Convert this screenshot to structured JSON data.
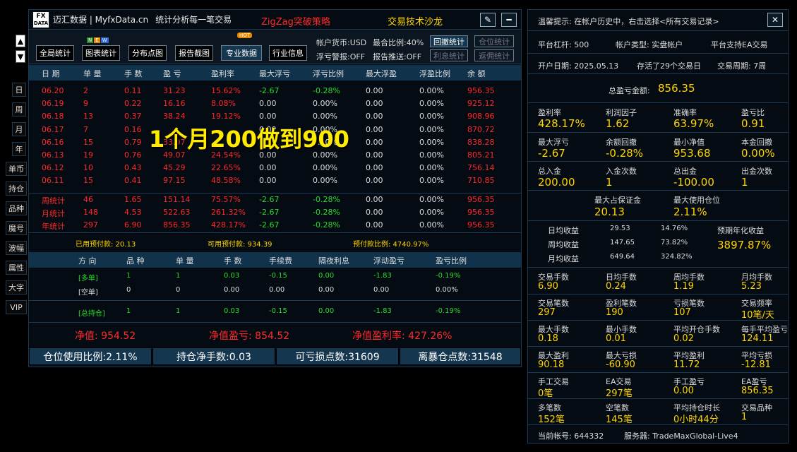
{
  "window": {
    "brand": "迈汇数据 | MyfxData.cn",
    "subtitle": "统计分析每一笔交易",
    "strategy": "ZigZag突破策略",
    "salon": "交易技术沙龙",
    "logo_top": "FX",
    "logo_bottom": "DATA"
  },
  "left_nav": {
    "up": "▲",
    "down": "▼",
    "items": [
      "日",
      "周",
      "月",
      "年",
      "单币",
      "持仓",
      "品种",
      "魔号",
      "波幅",
      "属性",
      "大字",
      "VIP"
    ]
  },
  "toolbar": {
    "buttons": [
      "全局统计",
      "图表统计",
      "分布点图",
      "报告截图",
      "专业数据",
      "行业信息"
    ],
    "new_badge": [
      "N",
      "E",
      "W"
    ],
    "hot_badge": "HOT",
    "account_currency": "帐户货币:USD",
    "max_ratio": "最合比例:40%",
    "float_alert": "浮亏警报:OFF",
    "report_push": "报告推送:OFF",
    "right_buttons": [
      "回撤统计",
      "仓位统计",
      "利息统计",
      "返佣统计"
    ]
  },
  "table": {
    "headers": [
      "日 期",
      "单 量",
      "手 数",
      "盈 亏",
      "盈利率",
      "最大浮亏",
      "浮亏比例",
      "最大浮盈",
      "浮盈比例",
      "余 额"
    ],
    "rows": [
      [
        "06.20",
        "2",
        "0.11",
        "31.23",
        "15.62%",
        "-2.67",
        "-0.28%",
        "0.00",
        "0.00%",
        "956.35"
      ],
      [
        "06.19",
        "9",
        "0.22",
        "16.16",
        "8.08%",
        "0.00",
        "0.00%",
        "0.00",
        "0.00%",
        "925.12"
      ],
      [
        "06.18",
        "13",
        "0.37",
        "38.24",
        "19.12%",
        "0.00",
        "0.00%",
        "0.00",
        "0.00%",
        "908.96"
      ],
      [
        "06.17",
        "7",
        "0.16",
        "",
        "",
        "0.00",
        "0.00%",
        "0.00",
        "0.00%",
        "870.72"
      ],
      [
        "06.16",
        "15",
        "0.79",
        "33.07",
        "",
        "",
        "0.00%",
        "0.00",
        "0.00%",
        "838.28"
      ],
      [
        "06.13",
        "19",
        "0.76",
        "49.07",
        "24.54%",
        "0.00",
        "0.00%",
        "0.00",
        "0.00%",
        "805.21"
      ],
      [
        "06.12",
        "10",
        "0.43",
        "45.29",
        "22.65%",
        "0.00",
        "0.00%",
        "0.00",
        "0.00%",
        "756.14"
      ],
      [
        "06.11",
        "15",
        "0.41",
        "97.15",
        "48.58%",
        "0.00",
        "0.00%",
        "0.00",
        "0.00%",
        "710.85"
      ]
    ],
    "summary": [
      [
        "周统计",
        "46",
        "1.65",
        "151.14",
        "75.57%",
        "-2.67",
        "-0.28%",
        "0.00",
        "0.00%",
        "956.35"
      ],
      [
        "月统计",
        "148",
        "4.53",
        "522.63",
        "261.32%",
        "-2.67",
        "-0.28%",
        "0.00",
        "0.00%",
        "956.35"
      ],
      [
        "年统计",
        "297",
        "6.90",
        "856.35",
        "428.17%",
        "-2.67",
        "-0.28%",
        "0.00",
        "0.00%",
        "956.35"
      ]
    ]
  },
  "overlay_text": "1个月200做到900",
  "margin": {
    "used": "已用预付款: 20.13",
    "available": "可用预付款: 934.39",
    "ratio": "预付款比例: 4740.97%"
  },
  "positions": {
    "headers": [
      "方 向",
      "品 种",
      "单 量",
      "手 数",
      "手续费",
      "隔夜利息",
      "浮动盈亏",
      "盈亏比例"
    ],
    "rows": [
      [
        "[多单]",
        "1",
        "1",
        "0.03",
        "-0.15",
        "0.00",
        "-1.83",
        "-0.19%"
      ],
      [
        "[空单]",
        "0",
        "0",
        "0.00",
        "0.00",
        "0.00",
        "0.00",
        "0.00%"
      ]
    ],
    "total": [
      "[总持仓]",
      "1",
      "1",
      "0.03",
      "-0.15",
      "0.00",
      "-1.83",
      "-0.19%"
    ]
  },
  "equity": {
    "net": "净值: 954.52",
    "net_pnl": "净值盈亏: 854.52",
    "net_rate": "净值盈利率: 427.26%"
  },
  "bottom_bar": [
    "仓位使用比例:2.11%",
    "持仓净手数:0.03",
    "可亏损点数:31609",
    "离暴仓点数:31548"
  ],
  "right": {
    "tip": "温馨提示: 在帐户历史中，右击选择<所有交易记录>",
    "close": "✕",
    "leverage": "平台杠杆: 500",
    "account_type": "帐户类型: 实盘帐户",
    "ea": "平台支持EA交易",
    "open_date": "开户日期: 2025.05.13",
    "days": "存活了29个交易日",
    "period": "交易周期: 7周",
    "total_label": "总盈亏金额:",
    "total_value": "856.35",
    "grid1": [
      [
        "盈利率",
        "428.17%"
      ],
      [
        "利润因子",
        "1.62"
      ],
      [
        "准确率",
        "63.97%"
      ],
      [
        "盈亏比",
        "0.91"
      ],
      [
        "最大浮亏",
        "-2.67"
      ],
      [
        "余额回撤",
        "-0.28%"
      ],
      [
        "最小净值",
        "953.68"
      ],
      [
        "本金回撤",
        "0.00%"
      ],
      [
        "总入金",
        "200.00"
      ],
      [
        "入金次数",
        "1"
      ],
      [
        "总出金",
        "-100.00"
      ],
      [
        "出金次数",
        "1"
      ]
    ],
    "margin_max_label": "最大占保证金",
    "margin_max": "20.13",
    "pos_max_label": "最大使用仓位",
    "pos_max": "2.11%",
    "daily": [
      [
        "日均收益",
        "29.53",
        "14.76%"
      ],
      [
        "周均收益",
        "147.65",
        "73.82%"
      ],
      [
        "月均收益",
        "649.64",
        "324.82%"
      ]
    ],
    "annual_label": "预期年化收益",
    "annual_value": "3897.87%",
    "grid2": [
      [
        "交易手数",
        "6.90"
      ],
      [
        "日均手数",
        "0.24"
      ],
      [
        "周均手数",
        "1.19"
      ],
      [
        "月均手数",
        "5.23"
      ],
      [
        "交易笔数",
        "297"
      ],
      [
        "盈利笔数",
        "190"
      ],
      [
        "亏损笔数",
        "107"
      ],
      [
        "交易频率",
        "10笔/天"
      ],
      [
        "最大手数",
        "0.18"
      ],
      [
        "最小手数",
        "0.01"
      ],
      [
        "平均开仓手数",
        "0.02"
      ],
      [
        "每手平均盈亏",
        "124.11"
      ],
      [
        "最大盈利",
        "90.18"
      ],
      [
        "最大亏损",
        "-60.90"
      ],
      [
        "平均盈利",
        "11.72"
      ],
      [
        "平均亏损",
        "-12.81"
      ],
      [
        "手工交易",
        "0笔"
      ],
      [
        "EA交易",
        "297笔"
      ],
      [
        "手工盈亏",
        "0.00"
      ],
      [
        "EA盈亏",
        "856.35"
      ],
      [
        "多笔数",
        "152笔"
      ],
      [
        "空笔数",
        "145笔"
      ],
      [
        "平均持仓时长",
        "0小时44分"
      ],
      [
        "交易品种",
        "1"
      ]
    ],
    "account": "当前帐号: 644332",
    "server": "服务器: TradeMaxGlobal-Live4"
  }
}
